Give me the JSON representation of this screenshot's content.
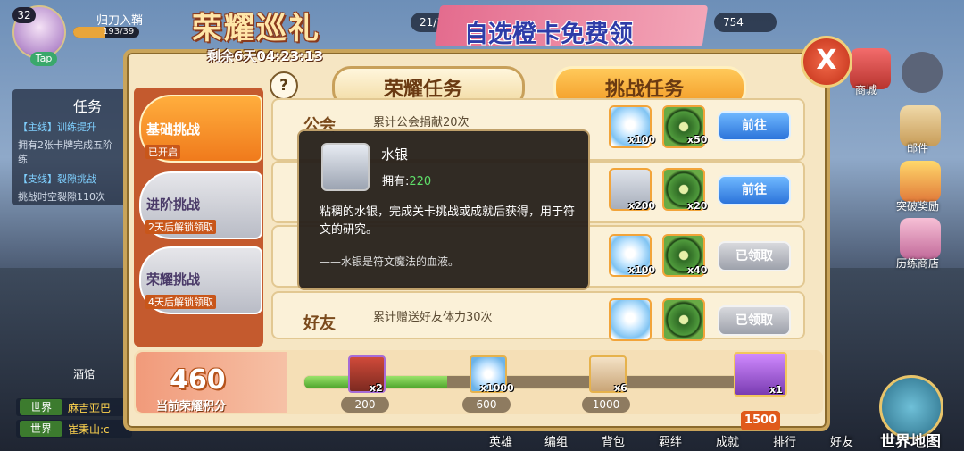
{
  "player": {
    "level": "32",
    "name": "归刀入鞘",
    "exp_text": "193/39",
    "exp_progress": 0.49,
    "tap_label": "Tap"
  },
  "resources": [
    {
      "value": "21/148"
    },
    {
      "value": "754"
    }
  ],
  "left_panel": {
    "quest_title": "任务",
    "quest_lines": [
      {
        "text": "【主线】训练提升",
        "type": "main"
      },
      {
        "text": "拥有2张卡牌完成五阶",
        "type": "normal"
      },
      {
        "text": "练",
        "type": "normal"
      },
      {
        "text": "【支线】裂隙挑战",
        "type": "main"
      },
      {
        "text": "挑战时空裂隙110次",
        "type": "normal"
      }
    ],
    "tavern_label": "酒馆",
    "chat": [
      {
        "channel": "世界",
        "name": "麻吉亚巴"
      },
      {
        "channel": "世界",
        "name": "崔秉山:c"
      }
    ]
  },
  "right_side": {
    "icons": [
      {
        "label": "商城",
        "icon": "shop-icon"
      },
      {
        "label": "邮件",
        "icon": "mail-icon"
      },
      {
        "label": "突破奖励",
        "icon": "breakthrough-reward-icon"
      },
      {
        "label": "历练商店",
        "icon": "training-shop-icon"
      }
    ],
    "world_map_label": "世界地图"
  },
  "bottom_nav": [
    "英雄",
    "编组",
    "背包",
    "羁绊",
    "成就",
    "排行",
    "好友"
  ],
  "event": {
    "title": "荣耀巡礼",
    "countdown": "剩余6天04:23:13",
    "promo_banner": "自选橙卡免费领",
    "close_label": "X",
    "help_label": "?",
    "top_tabs": [
      {
        "label": "荣耀任务",
        "active": false
      },
      {
        "label": "挑战任务",
        "active": true
      }
    ],
    "side_tabs": [
      {
        "name": "基础挑战",
        "status": "已开启",
        "active": true
      },
      {
        "name": "进阶挑战",
        "status": "2天后解锁领取",
        "active": false
      },
      {
        "name": "荣耀挑战",
        "status": "4天后解锁领取",
        "active": false
      }
    ],
    "tasks": [
      {
        "category": "公会",
        "description": "累计公会捐献20次",
        "rewards": [
          {
            "type": "gem",
            "qty": "x100"
          },
          {
            "type": "wheel",
            "qty": "x50"
          }
        ],
        "button": "前往",
        "button_state": "go"
      },
      {
        "category": "",
        "description": "",
        "rewards": [
          {
            "type": "cup",
            "qty": "x200"
          },
          {
            "type": "wheel",
            "qty": "x20"
          }
        ],
        "button": "前往",
        "button_state": "go"
      },
      {
        "category": "",
        "description": "",
        "rewards": [
          {
            "type": "gem",
            "qty": "x100"
          },
          {
            "type": "wheel",
            "qty": "x40"
          }
        ],
        "button": "已领取",
        "button_state": "done"
      },
      {
        "category": "好友",
        "description": "累计赠送好友体力30次",
        "rewards": [
          {
            "type": "gem",
            "qty": ""
          },
          {
            "type": "wheel",
            "qty": ""
          }
        ],
        "button": "已领取",
        "button_state": "done"
      }
    ],
    "tooltip": {
      "name": "水银",
      "have_label": "拥有:",
      "have_value": "220",
      "description": "粘稠的水银，完成关卡挑战或成就后获得，用于符文的研究。",
      "quote": "——水银是符文魔法的血液。"
    },
    "progress": {
      "score": "460",
      "score_label": "当前荣耀积分",
      "fill": 0.32,
      "milestones": [
        {
          "points": "200",
          "reward": "chest-icon",
          "qty": "x2"
        },
        {
          "points": "600",
          "reward": "gem-icon",
          "qty": "x1000"
        },
        {
          "points": "1000",
          "reward": "scroll-icon",
          "qty": "x6"
        },
        {
          "points": "1500",
          "reward": "skin-card-icon",
          "qty": "x1"
        }
      ]
    }
  },
  "colors": {
    "accent_orange": "#f07a1c",
    "go_blue": "#2c74da",
    "progress_green": "#4ca32a",
    "modal_bg": "#f6e6c3"
  }
}
